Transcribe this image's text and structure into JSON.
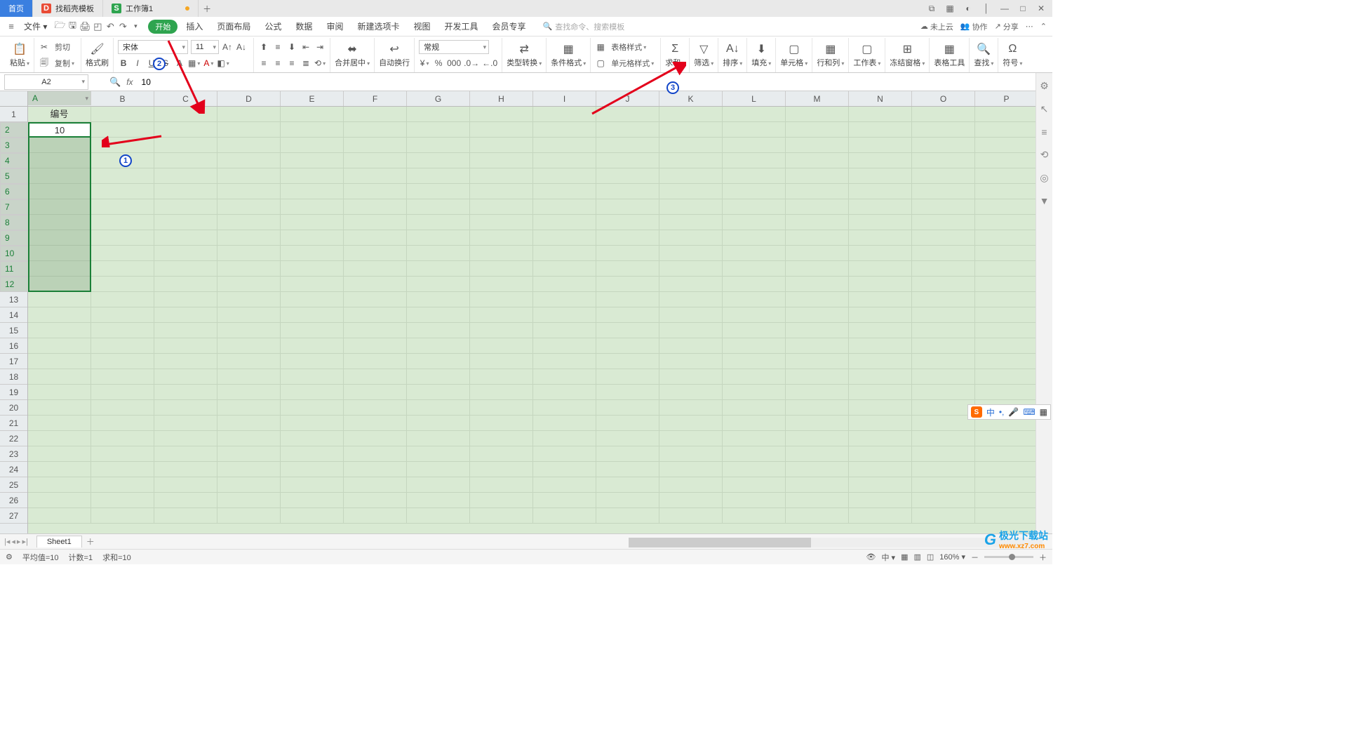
{
  "tabs": {
    "home": "首页",
    "tpl": "找稻壳模板",
    "doc": "工作簿1"
  },
  "menu": {
    "file": "文件",
    "start": "开始",
    "items": [
      "插入",
      "页面布局",
      "公式",
      "数据",
      "审阅",
      "新建选项卡",
      "视图",
      "开发工具",
      "会员专享"
    ],
    "search_ph": "查找命令、搜索模板",
    "cloud": "未上云",
    "coop": "协作",
    "share": "分享"
  },
  "ribbon": {
    "paste": "粘贴",
    "cut": "剪切",
    "copy": "复制",
    "fmt_painter": "格式刷",
    "font_name": "宋体",
    "font_size": "11",
    "merge": "合并居中",
    "wrap": "自动换行",
    "num_fmt": "常规",
    "type_conv": "类型转换",
    "cond_fmt": "条件格式",
    "table_style": "表格样式",
    "cell_style": "单元格样式",
    "sum": "求和",
    "filter": "筛选",
    "sort": "排序",
    "fill": "填充",
    "cell": "单元格",
    "rowcol": "行和列",
    "sheet": "工作表",
    "freeze": "冻结窗格",
    "table_tool": "表格工具",
    "find": "查找",
    "symbol": "符号"
  },
  "namebox": "A2",
  "formula": "10",
  "cols": [
    "A",
    "B",
    "C",
    "D",
    "E",
    "F",
    "G",
    "H",
    "I",
    "J",
    "K",
    "L",
    "M",
    "N",
    "O",
    "P"
  ],
  "rows": [
    "1",
    "2",
    "3",
    "4",
    "5",
    "6",
    "7",
    "8",
    "9",
    "10",
    "11",
    "12",
    "13",
    "14",
    "15",
    "16",
    "17",
    "18",
    "19",
    "20",
    "21",
    "22",
    "23",
    "24",
    "25",
    "26",
    "27"
  ],
  "cells": {
    "A1": "编号",
    "A2": "10"
  },
  "sheet": "Sheet1",
  "status": {
    "avg": "平均值=10",
    "cnt": "计数=1",
    "sum": "求和=10",
    "zoom": "160%"
  },
  "ime_lang": "中",
  "wm": {
    "name": "极光下载站",
    "url": "www.xz7.com"
  }
}
